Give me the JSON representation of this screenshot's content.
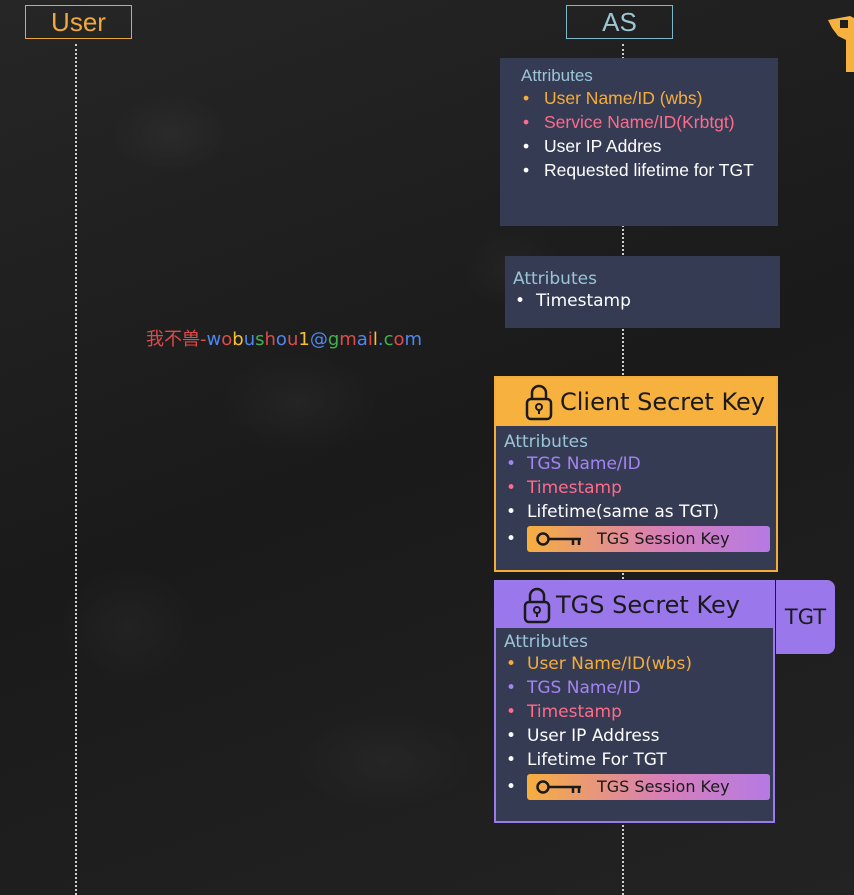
{
  "headers": {
    "user": "User",
    "as": "AS"
  },
  "request_panel": {
    "title": "Attributes",
    "items": [
      {
        "text": "User Name/ID (wbs)",
        "color": "#f5ad3a"
      },
      {
        "text": "Service Name/ID(Krbtgt)",
        "color": "#ff6b8a"
      },
      {
        "text": "User IP Addres",
        "color": "#ffffff"
      },
      {
        "text": "Requested lifetime for TGT",
        "color": "#ffffff"
      }
    ]
  },
  "timestamp_panel": {
    "title": "Attributes",
    "items": [
      {
        "text": "Timestamp"
      }
    ]
  },
  "client_secret_box": {
    "title": "Client Secret Key",
    "attributes_title": "Attributes",
    "items": [
      {
        "text": "TGS Name/ID",
        "color": "#a384f2"
      },
      {
        "text": "Timestamp",
        "color": "#ff6b8a"
      },
      {
        "text": "Lifetime(same as TGT)",
        "color": "#ffffff"
      }
    ],
    "session_key_label": "TGS Session Key"
  },
  "tgs_secret_box": {
    "title": "TGS Secret Key",
    "tab_label": "TGT",
    "attributes_title": "Attributes",
    "items": [
      {
        "text": "User Name/ID(wbs)",
        "color": "#f5ad3a"
      },
      {
        "text": "TGS Name/ID",
        "color": "#a384f2"
      },
      {
        "text": "Timestamp",
        "color": "#ff6b8a"
      },
      {
        "text": "User IP Address",
        "color": "#ffffff"
      },
      {
        "text": "Lifetime For TGT",
        "color": "#ffffff"
      }
    ],
    "session_key_label": "TGS Session Key"
  },
  "watermark": {
    "prefix": "我不兽-",
    "email": "wobushou1@gmail.com"
  },
  "colors": {
    "user_accent": "#f0a83c",
    "as_accent": "#9cc6d2",
    "client_box": "#f7b13e",
    "tgs_box": "#9a78ec",
    "panel_bg": "#363b54"
  }
}
